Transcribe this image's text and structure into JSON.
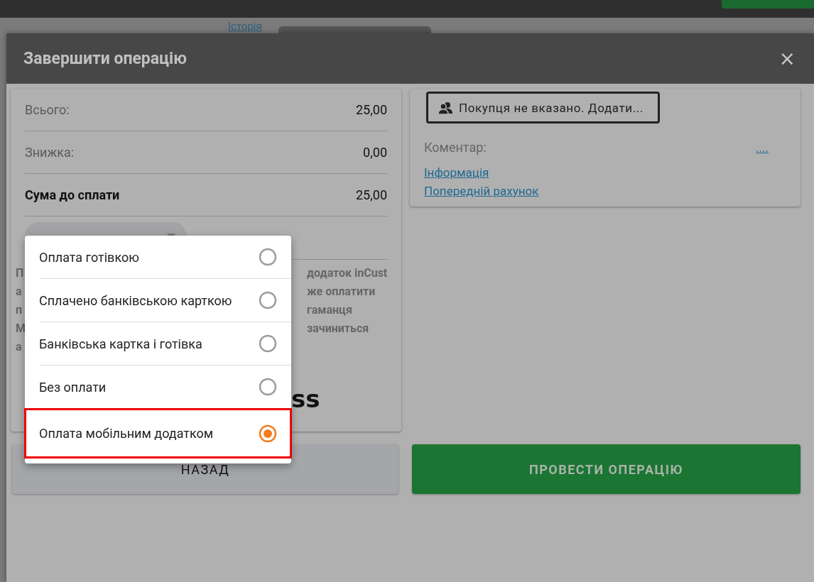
{
  "background": {
    "history_link": "Історія"
  },
  "dialog": {
    "title": "Завершити операцію",
    "close": "×"
  },
  "totals": [
    {
      "label": "Всього:",
      "value": "25,00",
      "emphasis": false
    },
    {
      "label": "Знижка:",
      "value": "0,00",
      "emphasis": false
    },
    {
      "label": "Сума до сплати",
      "value": "25,00",
      "emphasis": true
    }
  ],
  "payment_note": [
    {
      "left": "П",
      "right": "додаток inCust"
    },
    {
      "left": "а",
      "right": "же оплатити"
    },
    {
      "left": "п",
      "right": "гаманця"
    },
    {
      "left": "М",
      "right": "зачиниться"
    },
    {
      "left": "а"
    }
  ],
  "logo_fragment": "ss",
  "payment_options": [
    {
      "label": "Оплата готівкою",
      "selected": false
    },
    {
      "label": "Сплачено банківською карткою",
      "selected": false
    },
    {
      "label": "Банківська картка і готівка",
      "selected": false
    },
    {
      "label": "Без оплати",
      "selected": false
    },
    {
      "label": "Оплата мобільним додатком",
      "selected": true
    }
  ],
  "customer_button": "Покупця не вказано. Додати...",
  "comment": {
    "label": "Коментар:",
    "edit": "...."
  },
  "links": [
    "Інформація",
    "Попередній рахунок"
  ],
  "buttons": {
    "back": "НАЗАД",
    "submit": "ПРОВЕСТИ ОПЕРАЦІЮ"
  }
}
